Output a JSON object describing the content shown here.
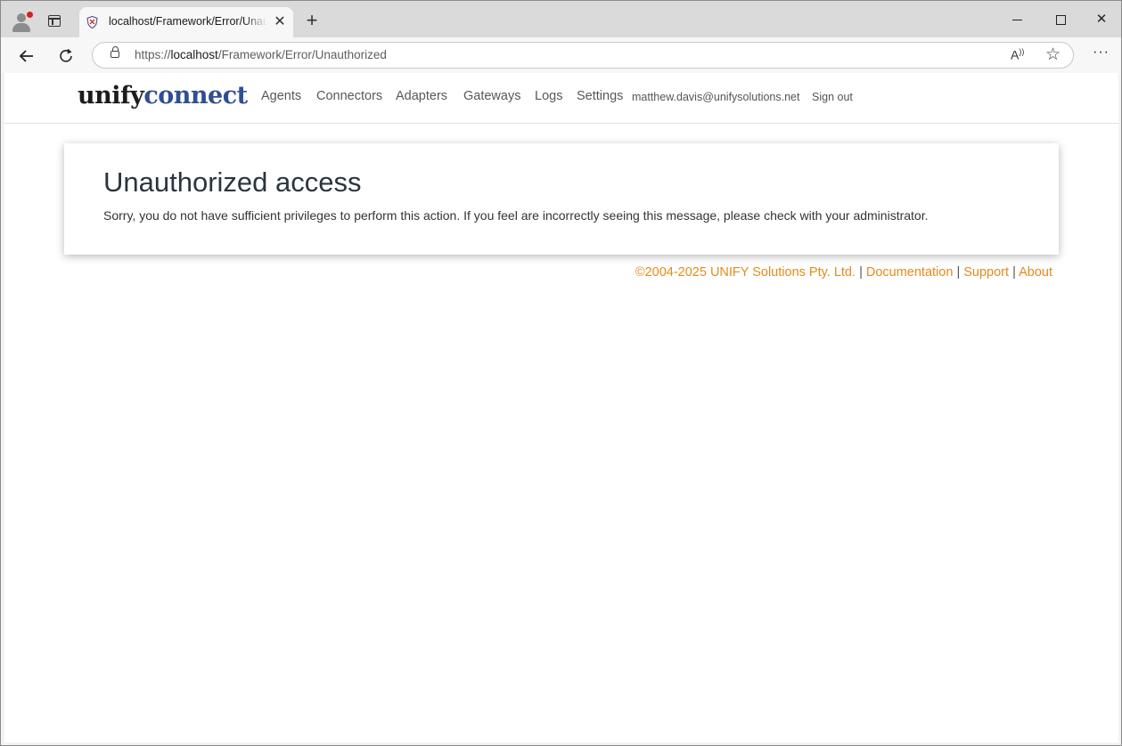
{
  "browser": {
    "tab": {
      "title": "localhost/Framework/Error/Unauthorized"
    },
    "address": {
      "scheme": "https://",
      "host": "localhost",
      "path": "/Framework/Error/Unauthorized"
    }
  },
  "site": {
    "logo": {
      "part1": "unify",
      "part2": "connect"
    },
    "nav": [
      "Agents",
      "Connectors",
      "Adapters",
      "Gateways",
      "Logs",
      "Settings"
    ],
    "user_email": "matthew.davis@unifysolutions.net",
    "signout_label": "Sign out"
  },
  "error": {
    "title": "Unauthorized access",
    "message": "Sorry, you do not have sufficient privileges to perform this action. If you feel are incorrectly seeing this message, please check with your administrator."
  },
  "footer": {
    "copyright": "©2004-2025 UNIFY Solutions Pty. Ltd.",
    "sep": "|",
    "links": [
      "Documentation",
      "Support",
      "About"
    ]
  },
  "colors": {
    "logo_accent": "#2f4e93",
    "footer_link": "#e68a1a"
  }
}
